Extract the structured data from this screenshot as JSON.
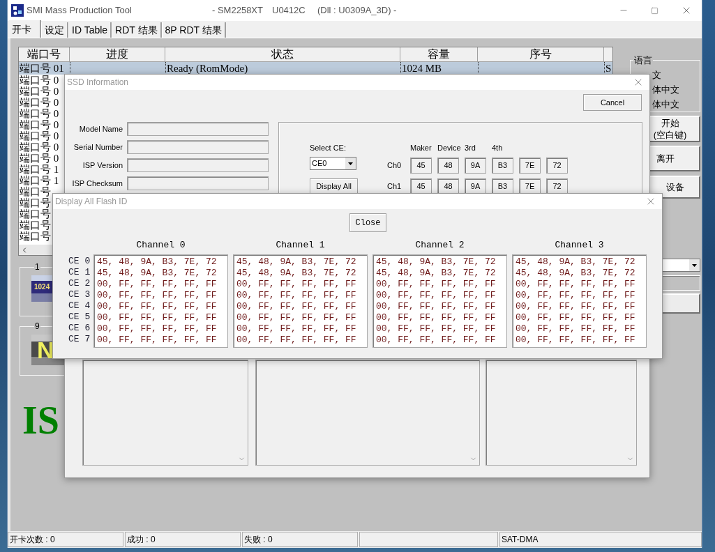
{
  "window": {
    "title": "SMI Mass Production Tool",
    "model": "- SM2258XT",
    "version": "U0412C",
    "dll": "(Dll : U0309A_3D) -"
  },
  "tabs": [
    {
      "label": "开卡",
      "selected": true
    },
    {
      "label": "设定",
      "selected": false
    },
    {
      "label": "ID Table",
      "selected": false
    },
    {
      "label": "RDT 结果",
      "selected": false
    },
    {
      "label": "8P RDT 结果",
      "selected": false
    }
  ],
  "port_table": {
    "columns": [
      "端口号",
      "进度",
      "状态",
      "容量",
      "序号"
    ],
    "rows": [
      {
        "cells": [
          "端口号 01",
          "",
          "Ready (RomMode)",
          "1024 MB",
          "",
          "S"
        ],
        "selected": true
      },
      {
        "cells": [
          "端口号 0"
        ],
        "selected": false
      },
      {
        "cells": [
          "端口号 0"
        ],
        "selected": false
      },
      {
        "cells": [
          "端口号 0"
        ],
        "selected": false
      },
      {
        "cells": [
          "端口号 0"
        ],
        "selected": false
      },
      {
        "cells": [
          "端口号 0"
        ],
        "selected": false
      },
      {
        "cells": [
          "端口号 0"
        ],
        "selected": false
      },
      {
        "cells": [
          "端口号 0"
        ],
        "selected": false
      },
      {
        "cells": [
          "端口号 0"
        ],
        "selected": false
      },
      {
        "cells": [
          "端口号 1"
        ],
        "selected": false
      },
      {
        "cells": [
          "端口号 1"
        ],
        "selected": false
      },
      {
        "cells": [
          "端口号"
        ],
        "selected": false
      },
      {
        "cells": [
          "端口号"
        ],
        "selected": false
      },
      {
        "cells": [
          "端口号"
        ],
        "selected": false
      },
      {
        "cells": [
          "端口号"
        ],
        "selected": false
      },
      {
        "cells": [
          "端口号"
        ],
        "selected": false
      }
    ]
  },
  "slots": [
    {
      "number": "1",
      "badge": "1024",
      "kind": "capacity"
    },
    {
      "number": "9",
      "badge": "N",
      "kind": "status"
    }
  ],
  "big_label": "IS",
  "language": {
    "title": "语言",
    "options": [
      "文",
      "体中文",
      "体中文"
    ]
  },
  "side_buttons": [
    {
      "lines": [
        "开始",
        "(空白键)"
      ]
    },
    {
      "lines": [
        "离开"
      ]
    },
    {
      "lines": [
        "设备"
      ]
    }
  ],
  "ssd_dialog": {
    "title": "SSD Information",
    "cancel": "Cancel",
    "fields": [
      {
        "label": "Model Name"
      },
      {
        "label": "Serial Number"
      },
      {
        "label": "ISP Version"
      },
      {
        "label": "ISP Checksum"
      }
    ],
    "select_ce": {
      "label": "Select CE:",
      "value": "CE0"
    },
    "display_all": "Display All",
    "id_headers": [
      "Maker",
      "Device",
      "3rd",
      "4th"
    ],
    "id_rows": [
      {
        "label": "Ch0",
        "values": [
          "45",
          "48",
          "9A",
          "B3",
          "7E",
          "72"
        ]
      },
      {
        "label": "Ch1",
        "values": [
          "45",
          "48",
          "9A",
          "B3",
          "7E",
          "72"
        ]
      }
    ]
  },
  "flash_dialog": {
    "title": "Display All Flash ID",
    "close": "Close",
    "ce_labels": [
      "CE 0",
      "CE 1",
      "CE 2",
      "CE 3",
      "CE 4",
      "CE 5",
      "CE 6",
      "CE 7"
    ],
    "channels": [
      {
        "title": "Channel 0",
        "rows": [
          "45, 48, 9A, B3, 7E, 72",
          "45, 48, 9A, B3, 7E, 72",
          "00, FF, FF, FF, FF, FF",
          "00, FF, FF, FF, FF, FF",
          "00, FF, FF, FF, FF, FF",
          "00, FF, FF, FF, FF, FF",
          "00, FF, FF, FF, FF, FF",
          "00, FF, FF, FF, FF, FF"
        ]
      },
      {
        "title": "Channel 1",
        "rows": [
          "45, 48, 9A, B3, 7E, 72",
          "45, 48, 9A, B3, 7E, 72",
          "00, FF, FF, FF, FF, FF",
          "00, FF, FF, FF, FF, FF",
          "00, FF, FF, FF, FF, FF",
          "00, FF, FF, FF, FF, FF",
          "00, FF, FF, FF, FF, FF",
          "00, FF, FF, FF, FF, FF"
        ]
      },
      {
        "title": "Channel 2",
        "rows": [
          "45, 48, 9A, B3, 7E, 72",
          "45, 48, 9A, B3, 7E, 72",
          "00, FF, FF, FF, FF, FF",
          "00, FF, FF, FF, FF, FF",
          "00, FF, FF, FF, FF, FF",
          "00, FF, FF, FF, FF, FF",
          "00, FF, FF, FF, FF, FF",
          "00, FF, FF, FF, FF, FF"
        ]
      },
      {
        "title": "Channel 3",
        "rows": [
          "45, 48, 9A, B3, 7E, 72",
          "45, 48, 9A, B3, 7E, 72",
          "00, FF, FF, FF, FF, FF",
          "00, FF, FF, FF, FF, FF",
          "00, FF, FF, FF, FF, FF",
          "00, FF, FF, FF, FF, FF",
          "00, FF, FF, FF, FF, FF",
          "00, FF, FF, FF, FF, FF"
        ]
      }
    ]
  },
  "status_bar": [
    {
      "kind": "text",
      "text": "开卡次数 : 0"
    },
    {
      "kind": "text",
      "text": "成功 : 0"
    },
    {
      "kind": "text",
      "text": "失败 : 0"
    },
    {
      "kind": "blank"
    },
    {
      "kind": "text",
      "text": "SAT-DMA"
    }
  ]
}
